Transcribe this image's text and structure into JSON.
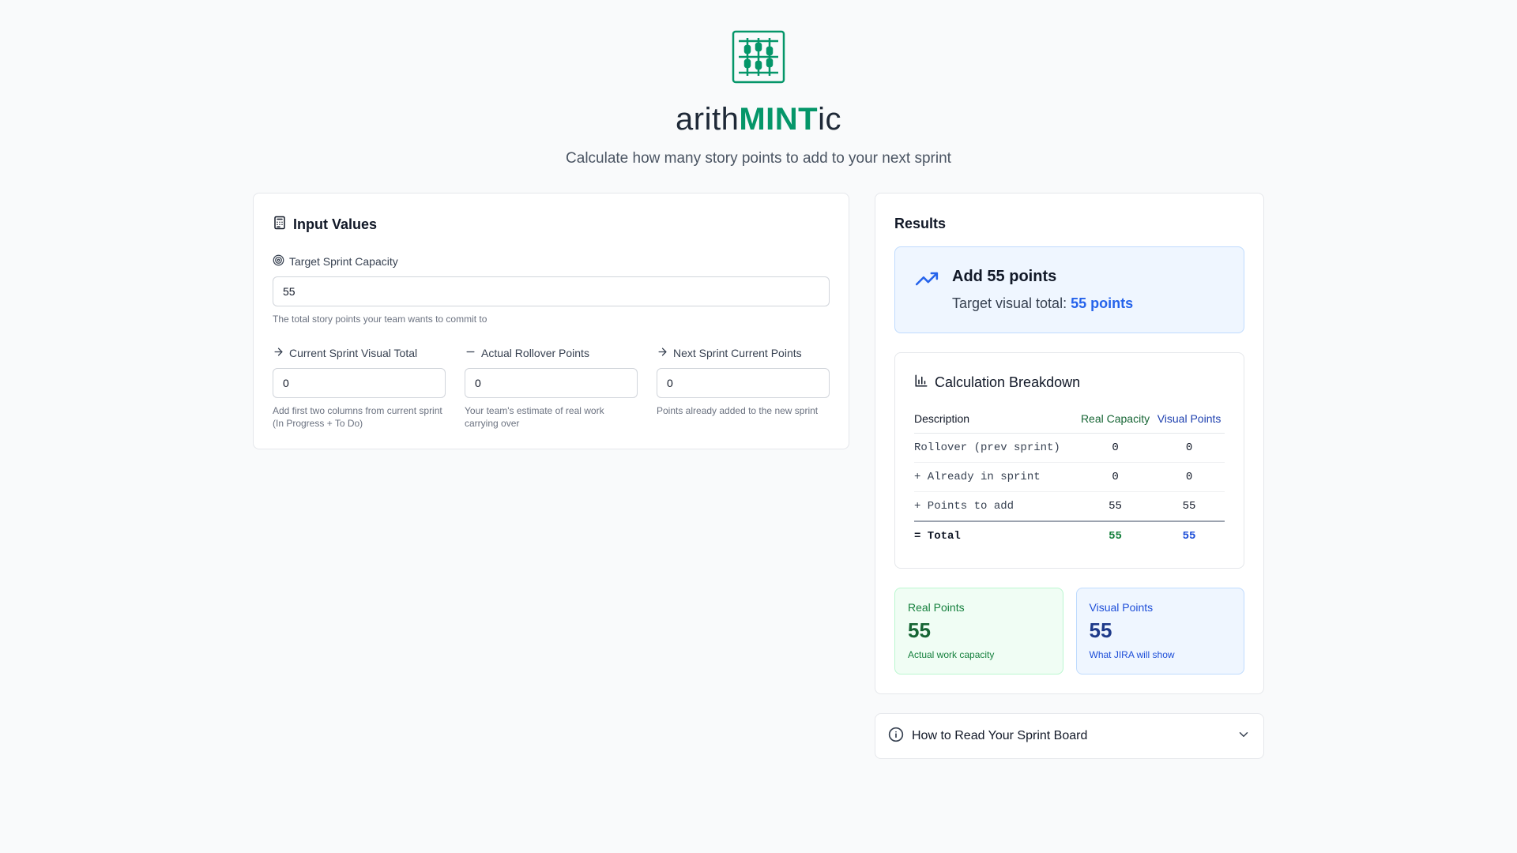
{
  "header": {
    "brand_prefix": "arith",
    "brand_highlight": "MINT",
    "brand_suffix": "ic",
    "tagline": "Calculate how many story points to add to your next sprint"
  },
  "inputs": {
    "title": "Input Values",
    "target": {
      "label": "Target Sprint Capacity",
      "value": "55",
      "help": "The total story points your team wants to commit to"
    },
    "current_visual": {
      "label": "Current Sprint Visual Total",
      "value": "0",
      "help": "Add first two columns from current sprint (In Progress + To Do)"
    },
    "rollover": {
      "label": "Actual Rollover Points",
      "value": "0",
      "help": "Your team's estimate of real work carrying over"
    },
    "next_current": {
      "label": "Next Sprint Current Points",
      "value": "0",
      "help": "Points already added to the new sprint"
    }
  },
  "results": {
    "title": "Results",
    "add_title": "Add 55 points",
    "target_visual_label": "Target visual total:",
    "target_visual_value": "55 points",
    "breakdown": {
      "title": "Calculation Breakdown",
      "headers": [
        "Description",
        "Real Capacity",
        "Visual Points"
      ],
      "rows": [
        {
          "desc": "Rollover (prev sprint)",
          "real": "0",
          "visual": "0"
        },
        {
          "desc": "+ Already in sprint",
          "real": "0",
          "visual": "0"
        },
        {
          "desc": "+ Points to add",
          "real": "55",
          "visual": "55"
        }
      ],
      "total": {
        "desc": "= Total",
        "real": "55",
        "visual": "55"
      }
    },
    "real_points": {
      "label": "Real Points",
      "value": "55",
      "note": "Actual work capacity"
    },
    "visual_points": {
      "label": "Visual Points",
      "value": "55",
      "note": "What JIRA will show"
    }
  },
  "howto": {
    "label": "How to Read Your Sprint Board"
  },
  "colors": {
    "brand": "#059669",
    "accent_blue": "#2563eb",
    "real_green": "#166534"
  },
  "icons": [
    "abacus-logo-icon",
    "calculator-icon",
    "target-icon",
    "arrow-right-icon",
    "minus-icon",
    "trending-up-icon",
    "bar-chart-icon",
    "info-icon",
    "chevron-down-icon"
  ]
}
